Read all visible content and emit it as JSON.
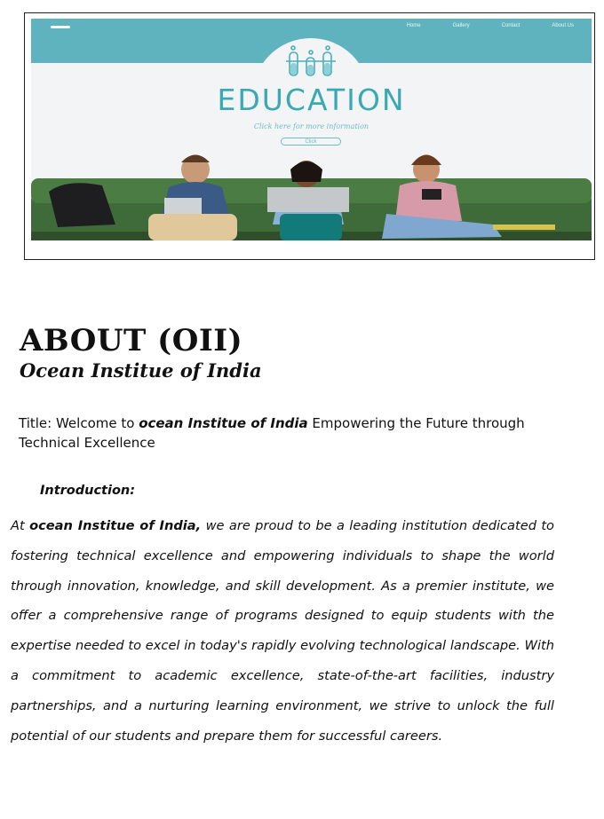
{
  "hero": {
    "nav": [
      "Home",
      "Gallery",
      "Contact",
      "About Us"
    ],
    "title": "EDUCATION",
    "subtitle": "Click here for more information",
    "button": "Click"
  },
  "about": {
    "heading": "ABOUT (OII)",
    "subheading": "Ocean Institue of India"
  },
  "title_line": {
    "prefix": "Title: Welcome to ",
    "institute": "ocean Institue of India",
    "suffix": " Empowering the Future through Technical Excellence"
  },
  "introduction": {
    "label": "Introduction:",
    "prefix": "At ",
    "institute": "ocean Institue of India,",
    "text": " we are proud to be a leading institution dedicated to fostering technical excellence and empowering individuals to shape the world through innovation, knowledge, and skill development. As a premier institute, we offer a comprehensive range of programs designed to equip students with the expertise needed to excel in today's rapidly evolving technological landscape. With a commitment to academic excellence, state-of-the-art facilities, industry partnerships, and a nurturing learning environment, we strive to unlock the full potential of our students and prepare them for successful careers."
  }
}
